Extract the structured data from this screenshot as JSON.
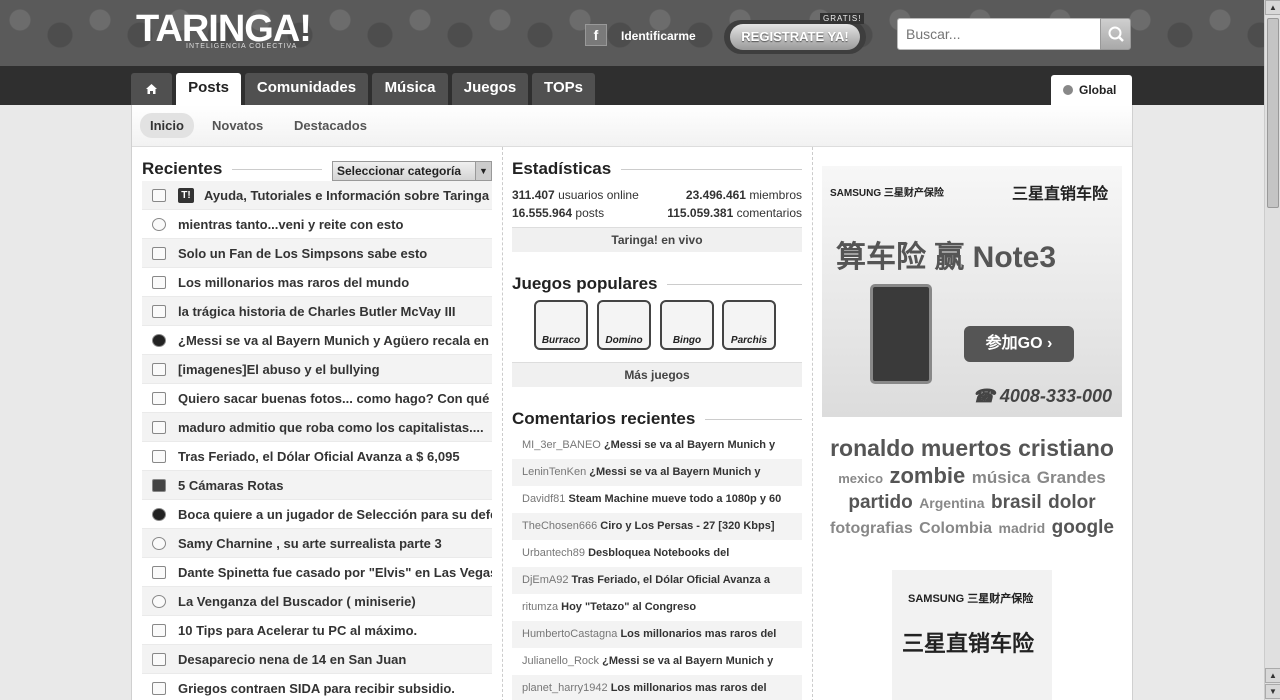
{
  "header": {
    "logo": "TARINGA!",
    "logo_sub": "INTELIGENCIA COLECTIVA",
    "login": "Identificarme",
    "register": "REGISTRATE YA!",
    "gratis": "GRATIS!",
    "search_placeholder": "Buscar..."
  },
  "nav": {
    "tabs": [
      "Posts",
      "Comunidades",
      "Música",
      "Juegos",
      "TOPs"
    ],
    "global": "Global"
  },
  "subnav": [
    "Inicio",
    "Novatos",
    "Destacados"
  ],
  "recientes": {
    "title": "Recientes",
    "category_select": "Seleccionar categoría",
    "posts": [
      "Ayuda, Tutoriales e Información sobre Taringa",
      "mientras tanto...veni y reite con esto",
      "Solo un Fan de Los Simpsons sabe esto",
      "Los millonarios mas raros del mundo",
      "la trágica historia de Charles Butler McVay III",
      "¿Messi se va al Bayern Munich y Agüero recala en Ba",
      "[imagenes]El abuso y el bullying",
      "Quiero sacar buenas fotos... como hago? Con qué c",
      "maduro admitio que roba como los capitalistas....",
      "Tras Feriado, el Dólar Oficial Avanza a $ 6,095",
      "5 Cámaras Rotas",
      "Boca quiere a un jugador de Selección para su defe",
      "Samy Charnine , su arte surrealista parte 3",
      "Dante Spinetta fue casado por \"Elvis\" en Las Vegas",
      "La Venganza del Buscador ( miniserie)",
      "10 Tips para Acelerar tu PC al máximo.",
      "Desaparecio nena de 14 en San Juan",
      "Griegos contraen SIDA para recibir subsidio."
    ]
  },
  "stats": {
    "title": "Estadísticas",
    "online_num": "311.407",
    "online_label": "usuarios online",
    "members_num": "23.496.461",
    "members_label": "miembros",
    "posts_num": "16.555.964",
    "posts_label": "posts",
    "comments_num": "115.059.381",
    "comments_label": "comentarios",
    "live": "Taringa! en vivo"
  },
  "games": {
    "title": "Juegos populares",
    "items": [
      "Burraco",
      "Domino",
      "Bingo",
      "Parchis"
    ],
    "more": "Más juegos"
  },
  "comments": {
    "title": "Comentarios recientes",
    "items": [
      {
        "user": "MI_3er_BANEO",
        "title": "¿Messi se va al Bayern Munich y"
      },
      {
        "user": "LeninTenKen",
        "title": "¿Messi se va al Bayern Munich y"
      },
      {
        "user": "Davidf81",
        "title": "Steam Machine mueve todo a 1080p y 60"
      },
      {
        "user": "TheChosen666",
        "title": "Ciro y Los Persas - 27 [320 Kbps]"
      },
      {
        "user": "Urbantech89",
        "title": "Desbloquea Notebooks del"
      },
      {
        "user": "DjEmA92",
        "title": "Tras Feriado, el Dólar Oficial Avanza a"
      },
      {
        "user": "ritumza",
        "title": "Hoy \"Tetazo\" al Congreso"
      },
      {
        "user": "HumbertoCastagna",
        "title": "Los millonarios mas raros del"
      },
      {
        "user": "Julianello_Rock",
        "title": "¿Messi se va al Bayern Munich y"
      },
      {
        "user": "planet_harry1942",
        "title": "Los millonarios mas raros del"
      }
    ]
  },
  "ad1": {
    "brand": "SAMSUNG 三星财产保险",
    "brand2": "三星直销车险",
    "main": "算车险 赢 Note3",
    "cta": "参加GO ›",
    "phone": "☎ 4008-333-000"
  },
  "tags": [
    {
      "text": "ronaldo",
      "size": 23
    },
    {
      "text": "muertos",
      "size": 23
    },
    {
      "text": "cristiano",
      "size": 23
    },
    {
      "text": "mexico",
      "size": 13
    },
    {
      "text": "zombie",
      "size": 22
    },
    {
      "text": "música",
      "size": 17
    },
    {
      "text": "Grandes",
      "size": 17
    },
    {
      "text": "partido",
      "size": 19
    },
    {
      "text": "Argentina",
      "size": 14
    },
    {
      "text": "brasil",
      "size": 19
    },
    {
      "text": "dolor",
      "size": 19
    },
    {
      "text": "fotografias",
      "size": 16
    },
    {
      "text": "Colombia",
      "size": 16
    },
    {
      "text": "madrid",
      "size": 14
    },
    {
      "text": "google",
      "size": 19
    }
  ],
  "ad2": {
    "brand": "SAMSUNG 三星财产保险",
    "main": "三星直销车险"
  }
}
